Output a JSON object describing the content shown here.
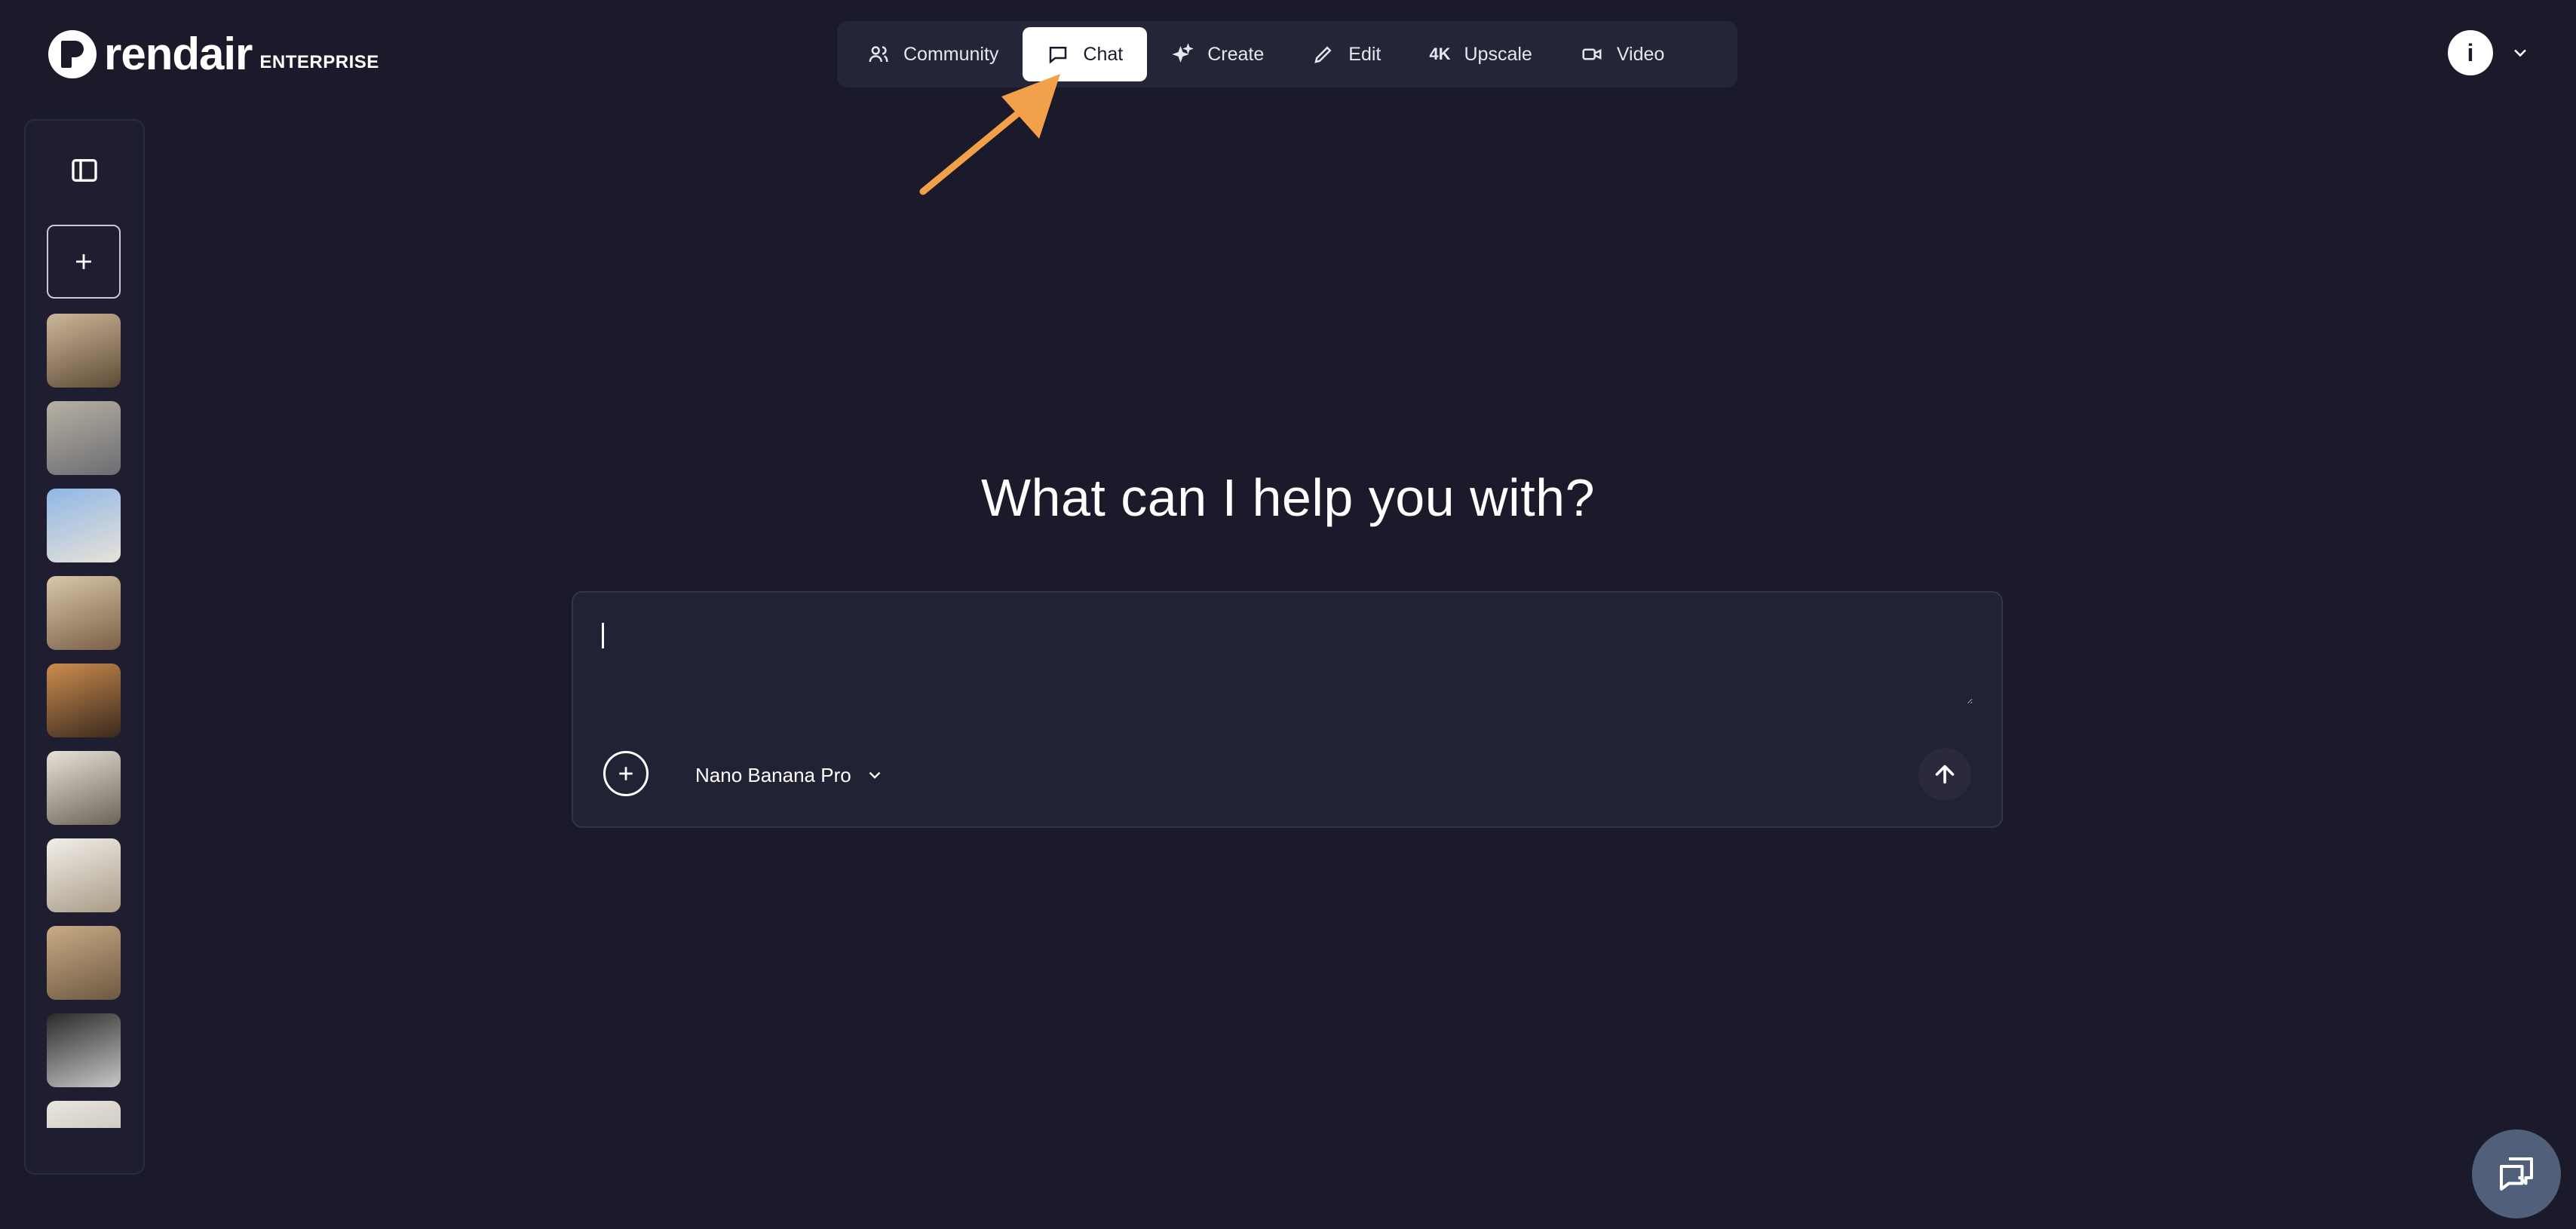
{
  "brand": {
    "name": "rendair",
    "tier": "ENTERPRISE"
  },
  "nav": {
    "items": [
      {
        "label": "Community",
        "icon": "users-icon",
        "active": false
      },
      {
        "label": "Chat",
        "icon": "chat-bubble-icon",
        "active": true
      },
      {
        "label": "Create",
        "icon": "sparkle-icon",
        "active": false
      },
      {
        "label": "Edit",
        "icon": "pencil-icon",
        "active": false
      },
      {
        "label": "Upscale",
        "icon": "4k-icon",
        "icon_text": "4K",
        "active": false
      },
      {
        "label": "Video",
        "icon": "video-camera-icon",
        "active": false
      }
    ]
  },
  "user": {
    "avatar_initial": "i"
  },
  "sidebar": {
    "thumbnails": [
      {
        "name": "thumbnail-1",
        "colors": [
          "#cdb79a",
          "#5f4a36"
        ]
      },
      {
        "name": "thumbnail-2",
        "colors": [
          "#b7b1a3",
          "#6c6c72"
        ]
      },
      {
        "name": "thumbnail-3",
        "colors": [
          "#8fb7e6",
          "#e8e2d8"
        ]
      },
      {
        "name": "thumbnail-4",
        "colors": [
          "#d9c7a8",
          "#7a6048"
        ]
      },
      {
        "name": "thumbnail-5",
        "colors": [
          "#cc8c4e",
          "#3a2a1e"
        ]
      },
      {
        "name": "thumbnail-6",
        "colors": [
          "#e7e2d8",
          "#6d6358"
        ]
      },
      {
        "name": "thumbnail-7",
        "colors": [
          "#f2efe9",
          "#a99b87"
        ]
      },
      {
        "name": "thumbnail-8",
        "colors": [
          "#c9ac86",
          "#6e5842"
        ]
      },
      {
        "name": "thumbnail-9",
        "colors": [
          "#2a2a2a",
          "#c8c8c8"
        ]
      },
      {
        "name": "thumbnail-10",
        "colors": [
          "#e9e6e0",
          "#bbb5aa"
        ]
      }
    ]
  },
  "main": {
    "title": "What can I help you with?",
    "composer": {
      "value": "",
      "placeholder": "",
      "model": "Nano Banana Pro"
    }
  },
  "colors": {
    "background": "#1a1a2b",
    "nav_bg": "#252538",
    "annotation_arrow": "#f2a04a",
    "help_widget": "#50607a"
  }
}
